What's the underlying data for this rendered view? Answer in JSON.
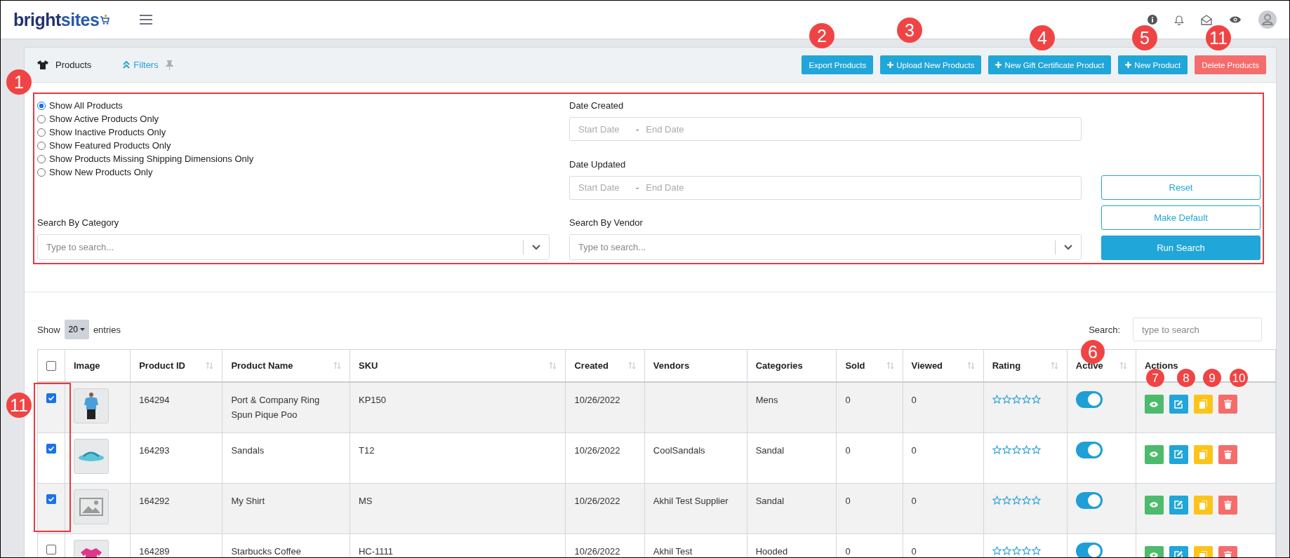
{
  "topbar": {
    "logo_dark": "bright",
    "logo_light": "sites"
  },
  "panel": {
    "title": "Products",
    "filters_toggle": "Filters"
  },
  "toolbar_buttons": [
    {
      "label": "Export Products",
      "kind": "plain"
    },
    {
      "label": "Upload New Products",
      "kind": "add"
    },
    {
      "label": "New Gift Certificate Product",
      "kind": "add"
    },
    {
      "label": "New Product",
      "kind": "add"
    },
    {
      "label": "Delete Products",
      "kind": "danger"
    }
  ],
  "filters": {
    "radios": [
      {
        "label": "Show All Products",
        "selected": true
      },
      {
        "label": "Show Active Products Only",
        "selected": false
      },
      {
        "label": "Show Inactive Products Only",
        "selected": false
      },
      {
        "label": "Show Featured Products Only",
        "selected": false
      },
      {
        "label": "Show Products Missing Shipping Dimensions Only",
        "selected": false
      },
      {
        "label": "Show New Products Only",
        "selected": false
      }
    ],
    "date_created": {
      "label": "Date Created",
      "start_placeholder": "Start Date",
      "separator": "-",
      "end_placeholder": "End Date"
    },
    "date_updated": {
      "label": "Date Updated",
      "start_placeholder": "Start Date",
      "separator": "-",
      "end_placeholder": "End Date"
    },
    "category": {
      "label": "Search By Category",
      "placeholder": "Type to search..."
    },
    "vendor": {
      "label": "Search By Vendor",
      "placeholder": "Type to search..."
    },
    "buttons": [
      {
        "label": "Reset",
        "kind": "outline"
      },
      {
        "label": "Make Default",
        "kind": "outline"
      },
      {
        "label": "Run Search",
        "kind": "solid"
      }
    ]
  },
  "table": {
    "show_label": "Show",
    "page_size": "20",
    "entries_label": "entries",
    "search_label": "Search:",
    "search_placeholder": "type to search",
    "select_all_checked": false,
    "columns": [
      {
        "label": "Image",
        "sortable": false
      },
      {
        "label": "Product ID",
        "sortable": true
      },
      {
        "label": "Product Name",
        "sortable": true
      },
      {
        "label": "SKU",
        "sortable": true
      },
      {
        "label": "Created",
        "sortable": true
      },
      {
        "label": "Vendors",
        "sortable": false
      },
      {
        "label": "Categories",
        "sortable": false
      },
      {
        "label": "Sold",
        "sortable": true
      },
      {
        "label": "Viewed",
        "sortable": true
      },
      {
        "label": "Rating",
        "sortable": true
      },
      {
        "label": "Active",
        "sortable": true
      },
      {
        "label": "Actions",
        "sortable": false
      }
    ],
    "rows": [
      {
        "checked": true,
        "kind": "shirt",
        "product_id": "164294",
        "name": "Port & Company Ring Spun Pique Poo",
        "sku": "KP150",
        "created": "10/26/2022",
        "vendor": "",
        "category": "Mens",
        "sold": "0",
        "viewed": "0",
        "stars": 0,
        "active": true
      },
      {
        "checked": true,
        "kind": "sandal",
        "product_id": "164293",
        "name": "Sandals",
        "sku": "T12",
        "created": "10/26/2022",
        "vendor": "CoolSandals",
        "category": "Sandal",
        "sold": "0",
        "viewed": "0",
        "stars": 0,
        "active": true
      },
      {
        "checked": true,
        "kind": "placeholder",
        "product_id": "164292",
        "name": "My Shirt",
        "sku": "MS",
        "created": "10/26/2022",
        "vendor": "Akhil Test Supplier",
        "category": "Sandal",
        "sold": "0",
        "viewed": "0",
        "stars": 0,
        "active": true
      },
      {
        "checked": false,
        "kind": "pink",
        "product_id": "164289",
        "name": "Starbucks Coffee",
        "sku": "HC-1111",
        "created": "10/26/2022",
        "vendor": "Akhil Test",
        "category": "Hooded",
        "sold": "0",
        "viewed": "0",
        "stars": 0,
        "active": true
      }
    ]
  },
  "callouts": [
    {
      "label": "1"
    },
    {
      "label": "2"
    },
    {
      "label": "3"
    },
    {
      "label": "4"
    },
    {
      "label": "5"
    },
    {
      "label": "11"
    },
    {
      "label": "6"
    },
    {
      "label": "7"
    },
    {
      "label": "8"
    },
    {
      "label": "9"
    },
    {
      "label": "10"
    },
    {
      "label": "11"
    }
  ]
}
